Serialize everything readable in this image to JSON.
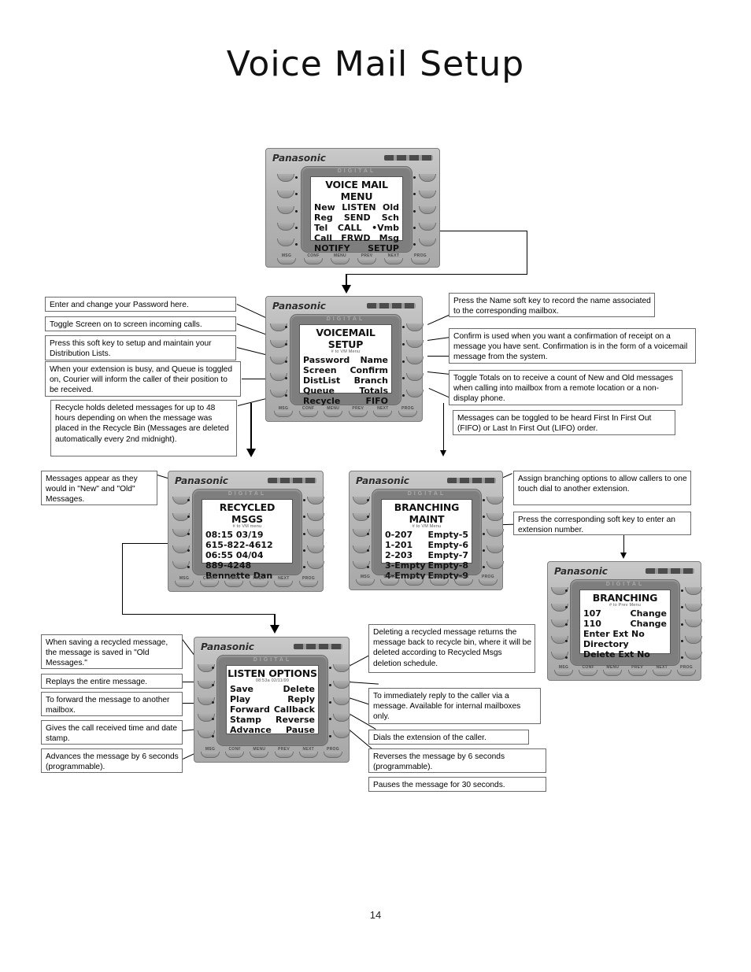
{
  "document": {
    "title": "Voice Mail Setup",
    "page_number": "14"
  },
  "phones": {
    "voice_mail_menu": {
      "brand": "Panasonic",
      "bezel_label": "DIGITAL",
      "lcd_title": "VOICE MAIL MENU",
      "lcd_subtitle": "",
      "rows": [
        {
          "left": "New",
          "center": "LISTEN",
          "right": "Old"
        },
        {
          "left": "Reg",
          "center": "SEND",
          "right": "Sch"
        },
        {
          "left": "Tel",
          "center": "CALL",
          "right": "•Vmb"
        },
        {
          "left": "Call",
          "center": "FRWD",
          "right": "Msg"
        },
        {
          "left": "NOTIFY",
          "center": "",
          "right": "SETUP"
        }
      ],
      "bottom_keys": [
        "MSG",
        "CONF",
        "MENU",
        "PREV",
        "NEXT",
        "PROG"
      ]
    },
    "voicemail_setup": {
      "brand": "Panasonic",
      "bezel_label": "DIGITAL",
      "lcd_title": "VOICEMAIL SETUP",
      "lcd_subtitle": "# to VM Menu",
      "rows": [
        {
          "left": "Password",
          "center": "",
          "right": "Name"
        },
        {
          "left": "Screen",
          "center": "",
          "right": "Confirm"
        },
        {
          "left": "DistList",
          "center": "",
          "right": "Branch"
        },
        {
          "left": "Queue",
          "center": "",
          "right": "Totals"
        },
        {
          "left": "Recycle",
          "center": "",
          "right": "FIFO"
        }
      ],
      "bottom_keys": [
        "MSG",
        "CONF",
        "MENU",
        "PREV",
        "NEXT",
        "PROG"
      ]
    },
    "recycled_msgs": {
      "brand": "Panasonic",
      "bezel_label": "DIGITAL",
      "lcd_title": "RECYCLED MSGS",
      "lcd_subtitle": "# to VM menu",
      "rows": [
        {
          "left": "08:15 03/19",
          "center": "",
          "right": ""
        },
        {
          "left": "615-822-4612",
          "center": "",
          "right": ""
        },
        {
          "left": "06:55 04/04",
          "center": "",
          "right": ""
        },
        {
          "left": "889-4248",
          "center": "",
          "right": ""
        },
        {
          "left": "Bennette Dan",
          "center": "",
          "right": ""
        }
      ],
      "bottom_keys": [
        "MSG",
        "CONF",
        "MENU",
        "PREV",
        "NEXT",
        "PROG"
      ]
    },
    "branching_maint": {
      "brand": "Panasonic",
      "bezel_label": "DIGITAL",
      "lcd_title": "BRANCHING MAINT",
      "lcd_subtitle": "# to VM Menu",
      "rows": [
        {
          "left": "0-207",
          "center": "",
          "right": "Empty-5"
        },
        {
          "left": "1-201",
          "center": "",
          "right": "Empty-6"
        },
        {
          "left": "2-203",
          "center": "",
          "right": "Empty-7"
        },
        {
          "left": "3-Empty",
          "center": "",
          "right": "Empty-8"
        },
        {
          "left": "4-Empty",
          "center": "",
          "right": "Empty-9"
        }
      ],
      "bottom_keys": [
        "MSG",
        "CONF",
        "MENU",
        "PREV",
        "NEXT",
        "PROG"
      ]
    },
    "branching": {
      "brand": "Panasonic",
      "bezel_label": "DIGITAL",
      "lcd_title": "BRANCHING",
      "lcd_subtitle": "# to Prev Menu",
      "rows": [
        {
          "left": "107",
          "center": "",
          "right": "Change"
        },
        {
          "left": "110",
          "center": "",
          "right": "Change"
        },
        {
          "left": "Enter Ext No",
          "center": "",
          "right": ""
        },
        {
          "left": "Directory",
          "center": "",
          "right": ""
        },
        {
          "left": "Delete Ext No",
          "center": "",
          "right": ""
        }
      ],
      "bottom_keys": [
        "MSG",
        "CONF",
        "MENU",
        "PREV",
        "NEXT",
        "PROG"
      ]
    },
    "listen_options": {
      "brand": "Panasonic",
      "bezel_label": "DIGITAL",
      "lcd_title": "LISTEN OPTIONS",
      "lcd_subtitle": "08:53a 02/11/99",
      "rows": [
        {
          "left": "Save",
          "center": "",
          "right": "Delete"
        },
        {
          "left": "Play",
          "center": "",
          "right": "Reply"
        },
        {
          "left": "Forward",
          "center": "",
          "right": "Callback"
        },
        {
          "left": "Stamp",
          "center": "",
          "right": "Reverse"
        },
        {
          "left": "Advance",
          "center": "",
          "right": "Pause"
        }
      ],
      "bottom_keys": [
        "MSG",
        "CONF",
        "MENU",
        "PREV",
        "NEXT",
        "PROG"
      ]
    }
  },
  "callouts": {
    "password": "Enter and change your Password here.",
    "screen": "Toggle Screen on to screen incoming calls.",
    "distlist": "Press this soft key to setup and maintain your Distribution Lists.",
    "queue": "When your extension is busy, and Queue is toggled on, Courier will inform the caller of their position to be received.",
    "recycle": "Recycle holds deleted messages for up to 48 hours depending on when the message was placed in the Recycle Bin (Messages are deleted automatically every 2nd midnight).",
    "name": "Press the Name soft key to record the name associated to the corresponding mailbox.",
    "confirm": "Confirm is used when you want a confirmation of receipt on a message you have sent.  Confirmation is in the form of a voicemail message from the system.",
    "totals": "Toggle Totals on to receive a count of New and Old messages when calling into mailbox from a remote location or a non-display phone.",
    "fifo": "Messages can be toggled to be heard First In First Out (FIFO) or Last In First Out (LIFO) order.",
    "recycled_msgs_note": "Messages appear as they would in \"New\" and \"Old\" Messages.",
    "branch_assign": "Assign branching options to allow callers to one touch dial to another extension.",
    "branch_softkey": "Press the corresponding soft key to enter an extension number.",
    "save": "When saving a recycled message, the message is saved in \"Old Messages.\"",
    "play": "Replays the entire message.",
    "forward": "To forward the message to another mailbox.",
    "stamp": "Gives the call received time and date stamp.",
    "advance": "Advances the message by 6 seconds (programmable).",
    "delete": "Deleting a recycled message returns the message back to recycle bin, where it will be deleted according to Recycled Msgs deletion schedule.",
    "reply": "To immediately reply to the caller via a message.  Available for internal mailboxes only.",
    "callback": "Dials the extension of the caller.",
    "reverse": "Reverses the message by 6 seconds (programmable).",
    "pause": "Pauses the message for 30 seconds."
  }
}
